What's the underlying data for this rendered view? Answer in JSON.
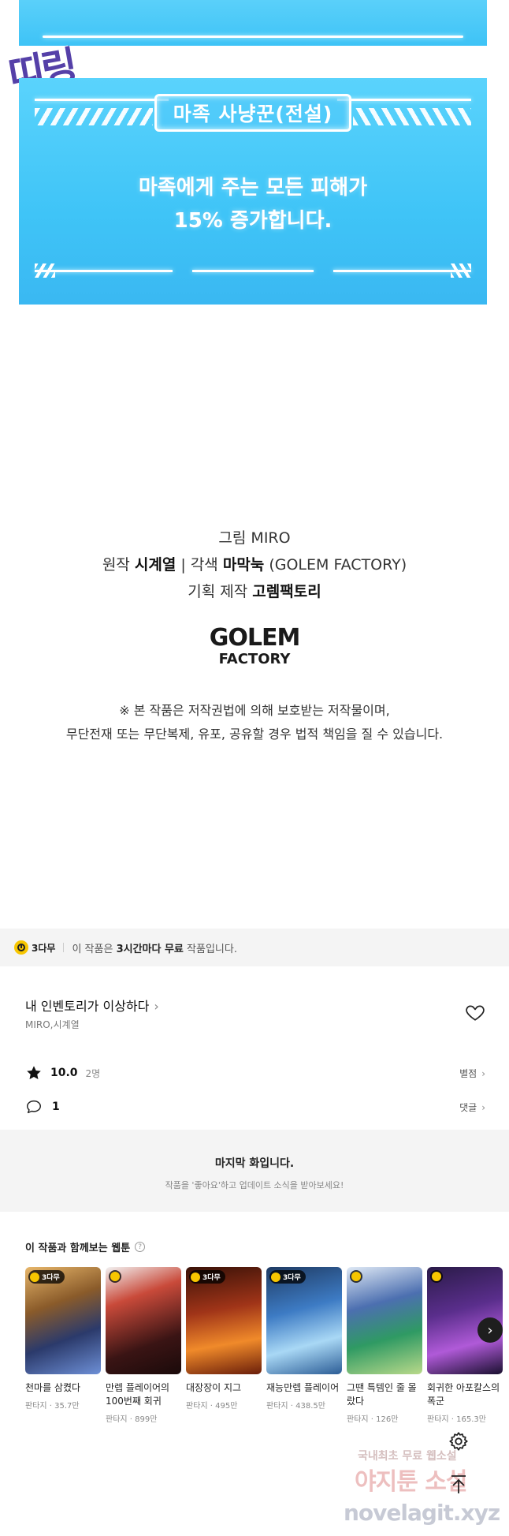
{
  "panel": {
    "sfx": "띠링",
    "skill_title": "마족 사냥꾼(전설)",
    "skill_desc_line1": "마족에게 주는 모든 피해가",
    "skill_desc_line2": "15% 증가합니다."
  },
  "credits": {
    "art_label": "그림",
    "art_value": "MIRO",
    "original_label": "원작",
    "original_value": "시계열",
    "sep": "|",
    "adapt_label": "각색",
    "adapt_value": "마막눅",
    "adapt_extra": "(GOLEM FACTORY)",
    "plan_label": "기획 제작",
    "plan_value": "고렘팩토리",
    "logo_line1": "GOLEM",
    "logo_line2": "FACTORY",
    "notice_line1": "※ 본 작품은 저작권법에 의해 보호받는 저작물이며,",
    "notice_line2": "무단전재 또는 무단복제, 유포, 공유할 경우 법적 책임을 질 수 있습니다."
  },
  "free_banner": {
    "badge": "3다무",
    "text_pre": "이 작품은",
    "text_bold": "3시간마다 무료",
    "text_post": "작품입니다."
  },
  "series": {
    "title": "내 인벤토리가 이상하다",
    "title_chev": "›",
    "authors": "MIRO,시계열",
    "score": "10.0",
    "rating_count": "2명",
    "rate_link": "별점",
    "comment_count": "1",
    "comment_link": "댓글",
    "chev": "›"
  },
  "last_episode": {
    "title": "마지막 화입니다.",
    "subtitle": "작품을 '좋아요'하고 업데이트 소식을 받아보세요!"
  },
  "recommendations": {
    "title": "이 작품과 함께보는 웹툰",
    "help": "?",
    "next": "›",
    "tag_label": "3다무",
    "items": [
      {
        "name": "천마를 삼켰다",
        "meta": "판타지 · 35.7만"
      },
      {
        "name": "만렙 플레이어의 100번째 회귀",
        "meta": "판타지 · 899만"
      },
      {
        "name": "대장장이 지그",
        "meta": "판타지 · 495만"
      },
      {
        "name": "재능만렙 플레이어",
        "meta": "판타지 · 438.5만"
      },
      {
        "name": "그땐 특템인 줄 몰랐다",
        "meta": "판타지 · 126만"
      },
      {
        "name": "회귀한 아포칼스의 폭군",
        "meta": "판타지 · 165.3만"
      }
    ]
  },
  "watermark": {
    "line1": "국내최초 무료 웹소설",
    "line2": "야지툰 소설",
    "line3": "novelagit.xyz"
  },
  "colors": {
    "panel_blue": "#3ec3f6",
    "accent_yellow": "#f7c600",
    "sfx_purple": "#5540a8"
  }
}
